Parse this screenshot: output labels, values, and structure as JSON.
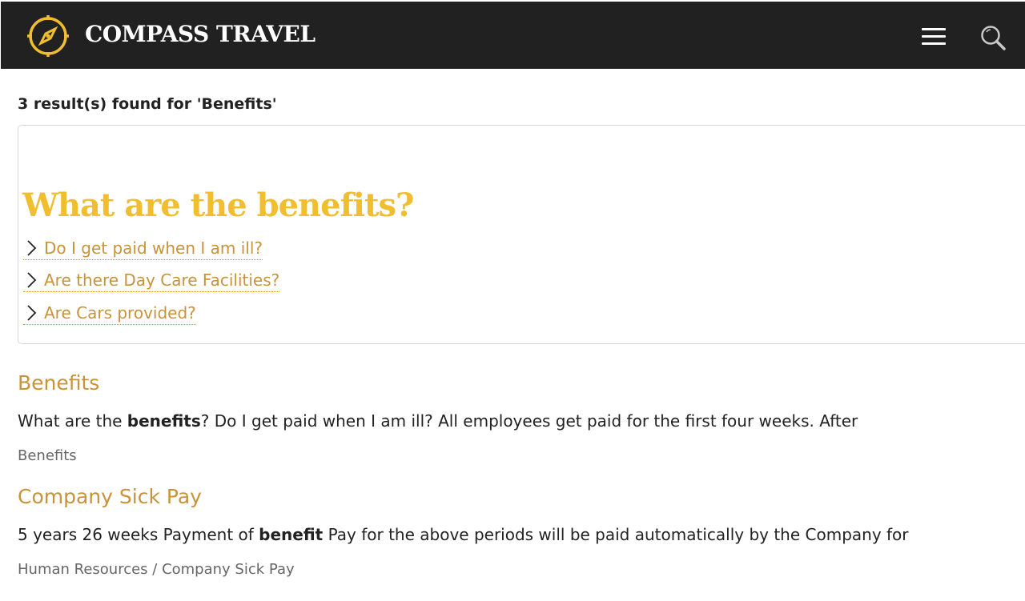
{
  "header": {
    "brand": "COMPASS TRAVEL",
    "logo_icon": "compass-icon",
    "menu_icon": "hamburger-menu-icon",
    "search_icon": "search-icon",
    "background_color": "#212121",
    "accent_color": "#f0be2e"
  },
  "search": {
    "summary": "3 result(s) found for 'Benefits'",
    "query": "Benefits"
  },
  "featured": {
    "title": "What are the benefits?",
    "links": [
      {
        "label": "Do I get paid when I am ill?"
      },
      {
        "label": "Are there Day Care Facilities?"
      },
      {
        "label": "Are Cars provided?"
      }
    ]
  },
  "results": [
    {
      "title": "Benefits",
      "excerpt_before": "What are the ",
      "excerpt_highlight": "benefits",
      "excerpt_after": "? Do I get paid when I am ill? All employees get paid for the first four weeks. After",
      "breadcrumb": "Benefits"
    },
    {
      "title": "Company Sick Pay",
      "excerpt_before": "5 years 26 weeks Payment of ",
      "excerpt_highlight": "benefit",
      "excerpt_after": " Pay for the above periods will be paid automatically by the Company for",
      "breadcrumb": "Human Resources / Company Sick Pay"
    }
  ],
  "colors": {
    "link": "#c8933a",
    "heading_accent": "#f0be2e",
    "breadcrumb": "#666666"
  }
}
